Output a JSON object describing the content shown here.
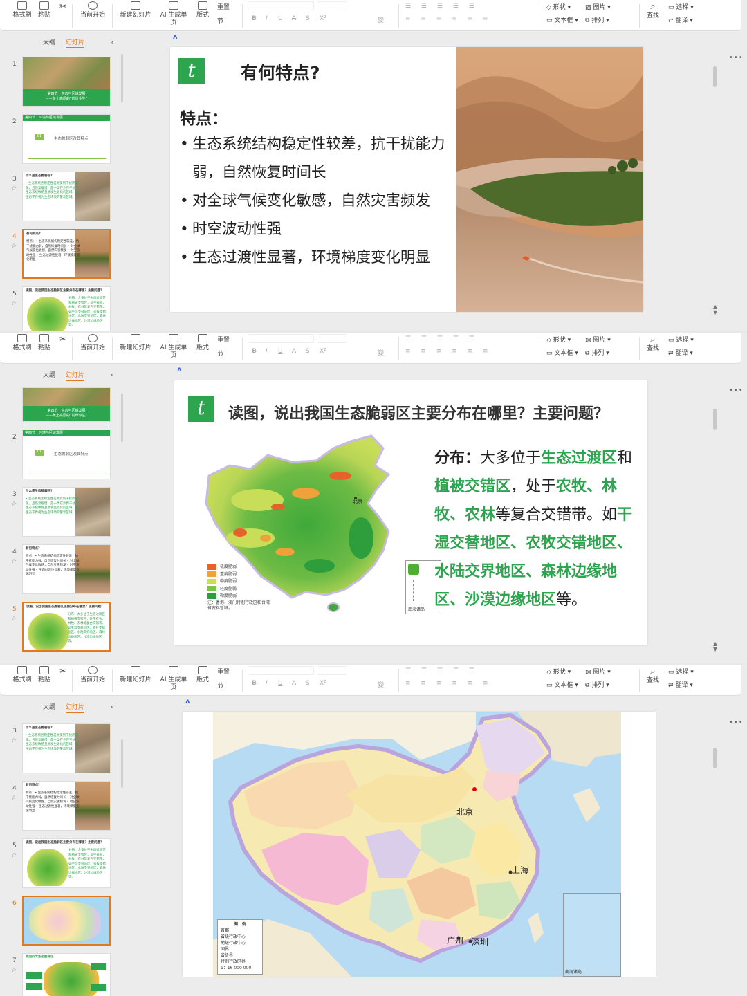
{
  "toolbar": {
    "format_painter": "格式刷",
    "paste": "粘贴",
    "start_from": "当前开始",
    "new_slide": "新建幻灯片",
    "ai_slide": "AI 生成单页",
    "layout": "版式",
    "reset": "重置",
    "section": "节",
    "bold": "B",
    "italic": "I",
    "underline": "U",
    "strike": "A",
    "shadow": "S",
    "superscript": "X²",
    "pinyin": "變",
    "shape": "形状",
    "picture": "图片",
    "textbox": "文本框",
    "arrange": "排列",
    "find": "查找",
    "select": "选择",
    "translate": "翻译"
  },
  "sidebar": {
    "tab_outline": "大纲",
    "tab_slides": "幻灯片",
    "collapse_icon": "chevron-left-icon"
  },
  "thumbs": {
    "t1_title": "第四节　生态与区域发展",
    "t1_subtitle": "——黄土高原的“前世今生”",
    "t2_head": "第四节　环境与区域发展",
    "t2_num": "01",
    "t2_text": "生态脆弱区及其特点",
    "t3_head": "什么是生态脆弱区?",
    "t3_text": "• 生态系统因稳定性差易受到干扰而退化，且恢复缓慢，是一类在外界干扰下生态系统敏感且易发生退化的区域，被生态学界视为生态环境的警示区域。",
    "t4_head": "有何特点?",
    "t4_text": "特点：• 生态系统结构稳定性较差，抗干扰能力弱，自然恢复时间长 • 对全球气候变化敏感，自然灾害频发 • 时空波动性强 • 生态过渡性显著，环境梯度变化明显",
    "t5_head": "读图，说出我国生态脆弱区主要分布在哪里？主要问题？",
    "t5_text": "分布：大多位于生态过渡区和植被交错区，处于农牧、林牧、农林等复合交错带。如干湿交替地区、农牧交错地区、水陆交界地区、森林边缘地区、沙漠边缘地区等。",
    "t7_head": "我国四大生态脆弱区"
  },
  "slide4": {
    "title": "有何特点?",
    "heading": "特点：",
    "bullets": [
      "生态系统结构稳定性较差，抗干扰能力弱，自然恢复时间长",
      "对全球气候变化敏感，自然灾害频发",
      "时空波动性强",
      "生态过渡性显著，环境梯度变化明显"
    ]
  },
  "slide5": {
    "title": "读图，说出我国生态脆弱区主要分布在哪里？主要问题？",
    "dist_label": "分布：",
    "t1": "大多位于",
    "g1": "生态过渡区",
    "t2": "和",
    "g2": "植被交错区",
    "t3": "，处于",
    "g3": "农牧、林牧、农林",
    "t4": "等复合交错带。如",
    "g4": "干湿交替地区、农牧交错地区、水陆交界地区、森林边缘地区、沙漠边缘地区",
    "t5": "等。",
    "legend": [
      "极度脆弱",
      "重度脆弱",
      "中度脆弱",
      "轻度脆弱",
      "微度脆弱"
    ],
    "legend_colors": [
      "#e5622b",
      "#f0a23a",
      "#c9de58",
      "#7cc34c",
      "#2e9d3c"
    ],
    "note": "注：香港、澳门特别行政区和台湾省资料暂缺。",
    "beijing": "北京",
    "south_sea": "南海诸岛"
  },
  "slide6": {
    "beijing": "北京",
    "shanghai": "上海",
    "guangzhou": "广州",
    "shenzhen": "深圳",
    "legend_title": "图　例",
    "legend_items": [
      "首都",
      "省级行政中心",
      "地级行政中心",
      "国界",
      "省级界",
      "特别行政区界"
    ],
    "scale": "1：16 000 000",
    "south_sea": "南海诸岛"
  }
}
